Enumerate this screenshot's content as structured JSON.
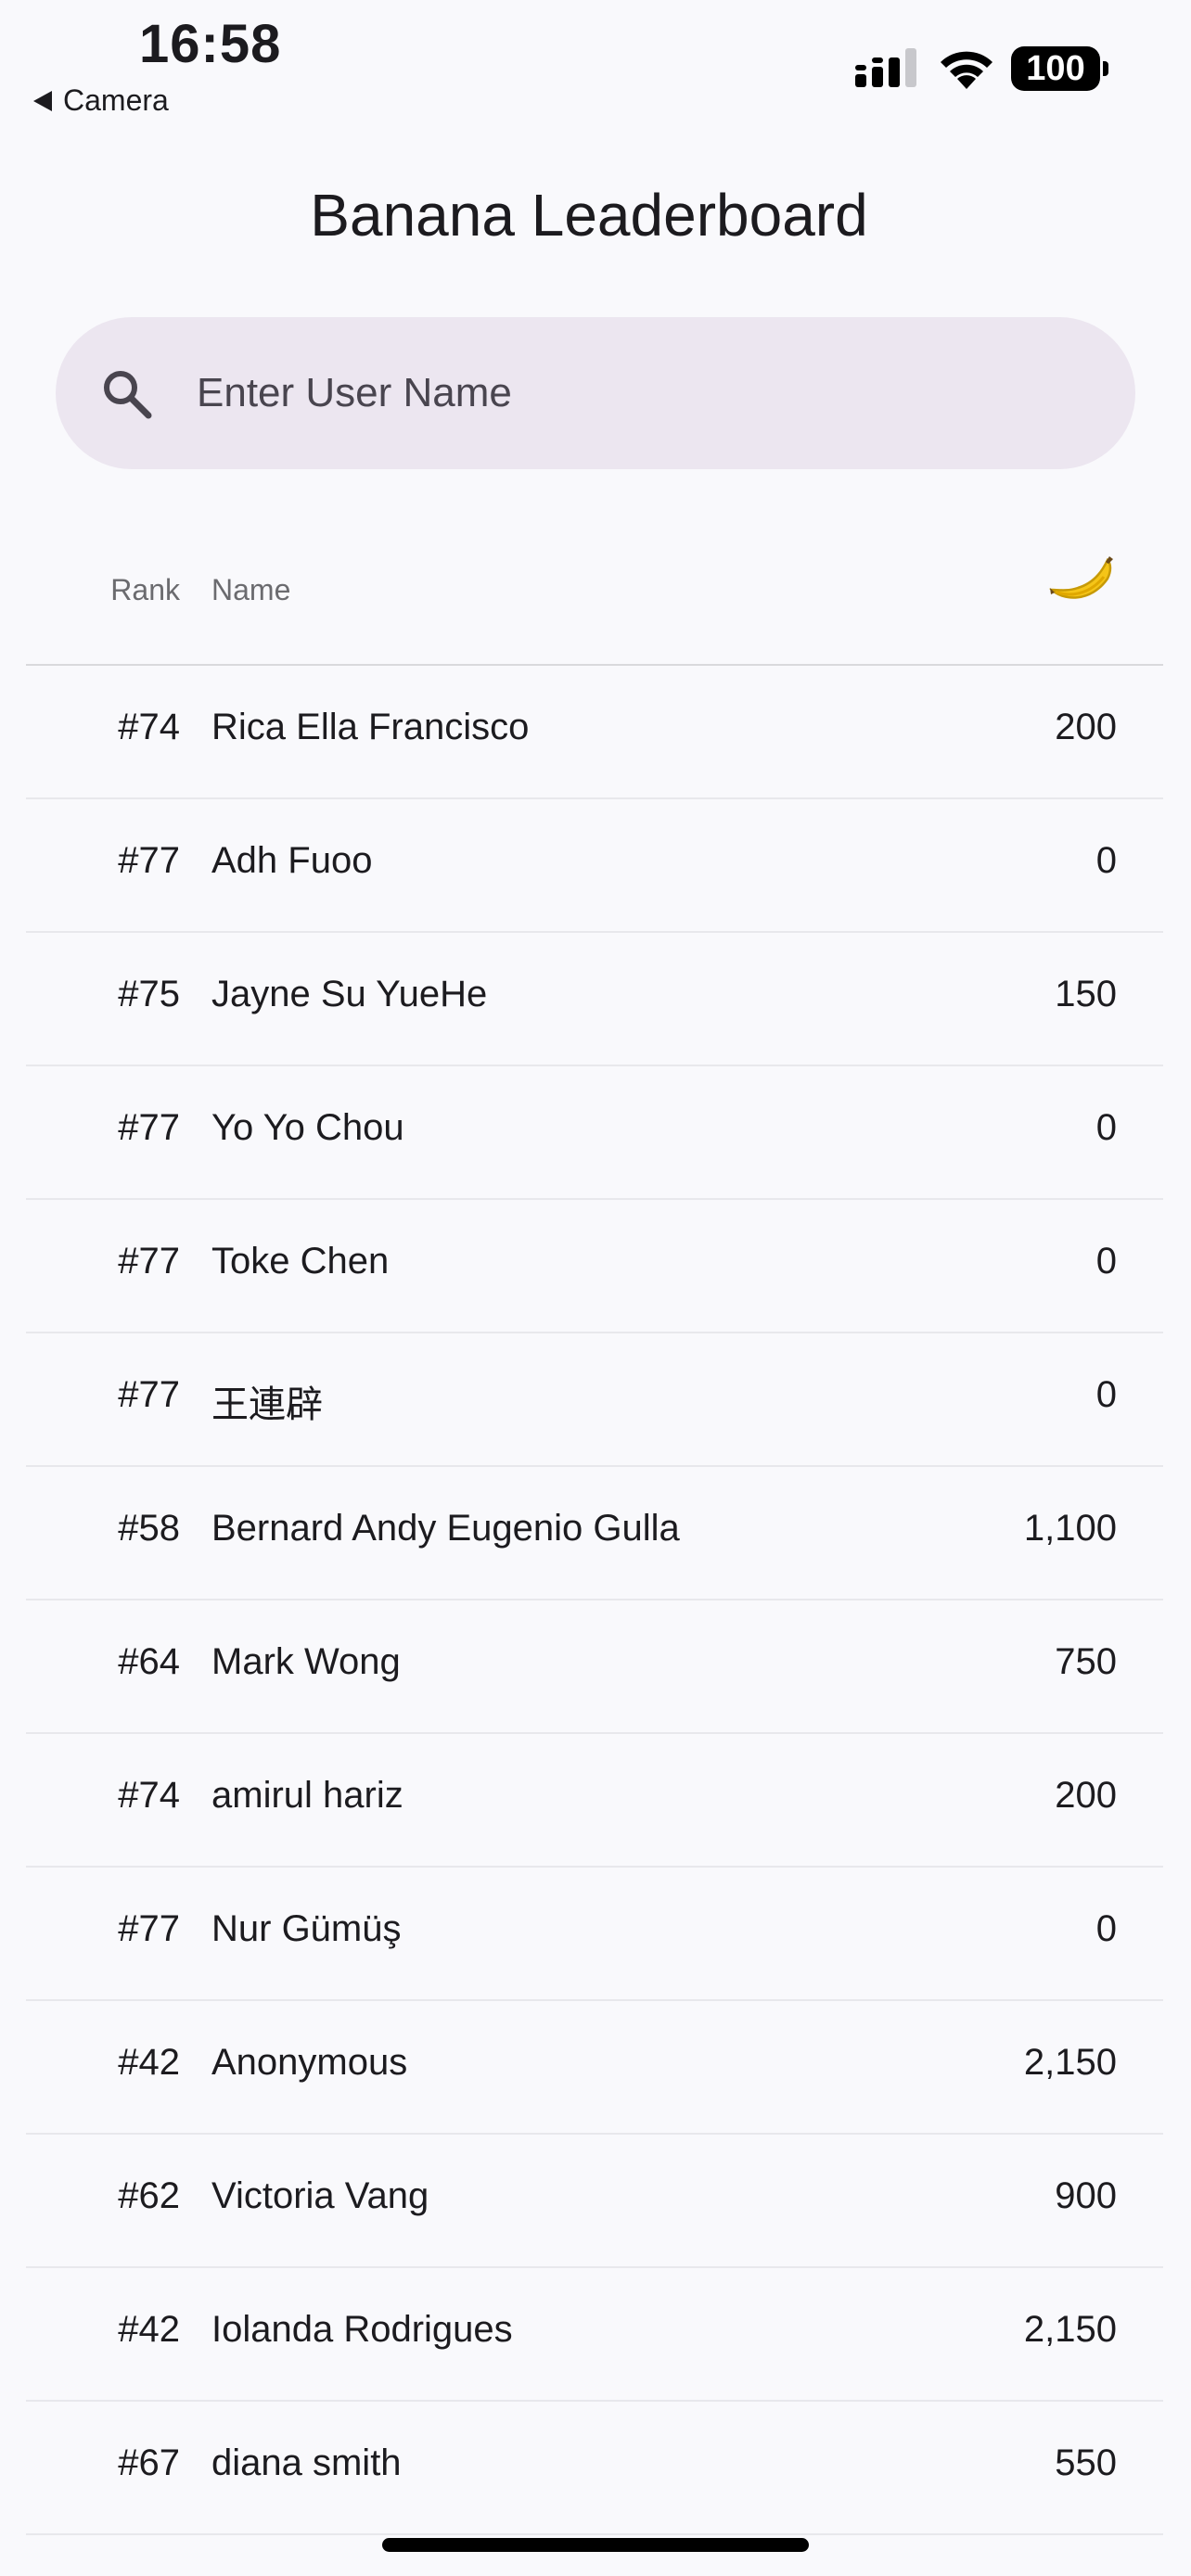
{
  "status_bar": {
    "time": "16:58",
    "back_label": "Camera",
    "battery": "100"
  },
  "page": {
    "title": "Banana Leaderboard"
  },
  "search": {
    "placeholder": "Enter User Name",
    "value": ""
  },
  "table": {
    "columns": {
      "rank": "Rank",
      "name": "Name",
      "score_icon": "banana-icon"
    },
    "rows": [
      {
        "rank": "#74",
        "name": "Rica Ella Francisco",
        "score": "200"
      },
      {
        "rank": "#77",
        "name": "Adh Fuoo",
        "score": "0"
      },
      {
        "rank": "#75",
        "name": "Jayne Su YueHe",
        "score": "150"
      },
      {
        "rank": "#77",
        "name": "Yo Yo Chou",
        "score": "0"
      },
      {
        "rank": "#77",
        "name": "Toke Chen",
        "score": "0"
      },
      {
        "rank": "#77",
        "name": "王連辟",
        "score": "0"
      },
      {
        "rank": "#58",
        "name": "Bernard Andy Eugenio Gulla",
        "score": "1,100"
      },
      {
        "rank": "#64",
        "name": "Mark Wong",
        "score": "750"
      },
      {
        "rank": "#74",
        "name": "amirul hariz",
        "score": "200"
      },
      {
        "rank": "#77",
        "name": "Nur Gümüş",
        "score": "0"
      },
      {
        "rank": "#42",
        "name": "Anonymous",
        "score": "2,150"
      },
      {
        "rank": "#62",
        "name": "Victoria Vang",
        "score": "900"
      },
      {
        "rank": "#42",
        "name": "Iolanda Rodrigues",
        "score": "2,150"
      },
      {
        "rank": "#67",
        "name": "diana smith",
        "score": "550"
      }
    ]
  }
}
